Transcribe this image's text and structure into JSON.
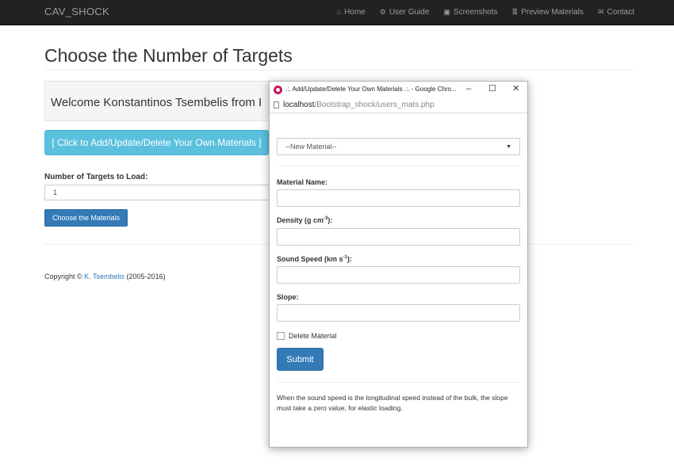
{
  "navbar": {
    "brand": "CAV_SHOCK",
    "items": [
      {
        "label": "Home",
        "icon": "home-icon"
      },
      {
        "label": "User Guide",
        "icon": "gears-icon"
      },
      {
        "label": "Screenshots",
        "icon": "picture-icon"
      },
      {
        "label": "Preview Materials",
        "icon": "database-icon"
      },
      {
        "label": "Contact",
        "icon": "envelope-icon"
      }
    ]
  },
  "main": {
    "title": "Choose the Number of Targets",
    "welcome": "Welcome Konstantinos Tsembelis from I",
    "materials_button": "[ Click to Add/Update/Delete Your Own Materials ]",
    "targets_label": "Number of Targets to Load:",
    "targets_value": "1",
    "choose_button": "Choose the Materials",
    "copyright_prefix": "Copyright ©",
    "copyright_link": "K. Tsembelis",
    "copyright_suffix": "(2005-2016)"
  },
  "popup": {
    "window_title": ".:. Add/Update/Delete Your Own Materials .:. - Google Chro...",
    "url_host": "localhost",
    "url_path": "/Bootstrap_shock/users_mats.php",
    "select_value": "--New Material--",
    "fields": {
      "name_label": "Material Name:",
      "density_label": "Density (g cm",
      "density_sup": "-3",
      "density_suffix": "):",
      "speed_label": "Sound Speed (km s",
      "speed_sup": "-1",
      "speed_suffix": "):",
      "slope_label": "Slope:"
    },
    "delete_label": "Delete Material",
    "submit_label": "Submit",
    "note": "When the sound speed is the longitudinal speed instead of the bulk, the slope must take a zero value, for elastic loading."
  }
}
